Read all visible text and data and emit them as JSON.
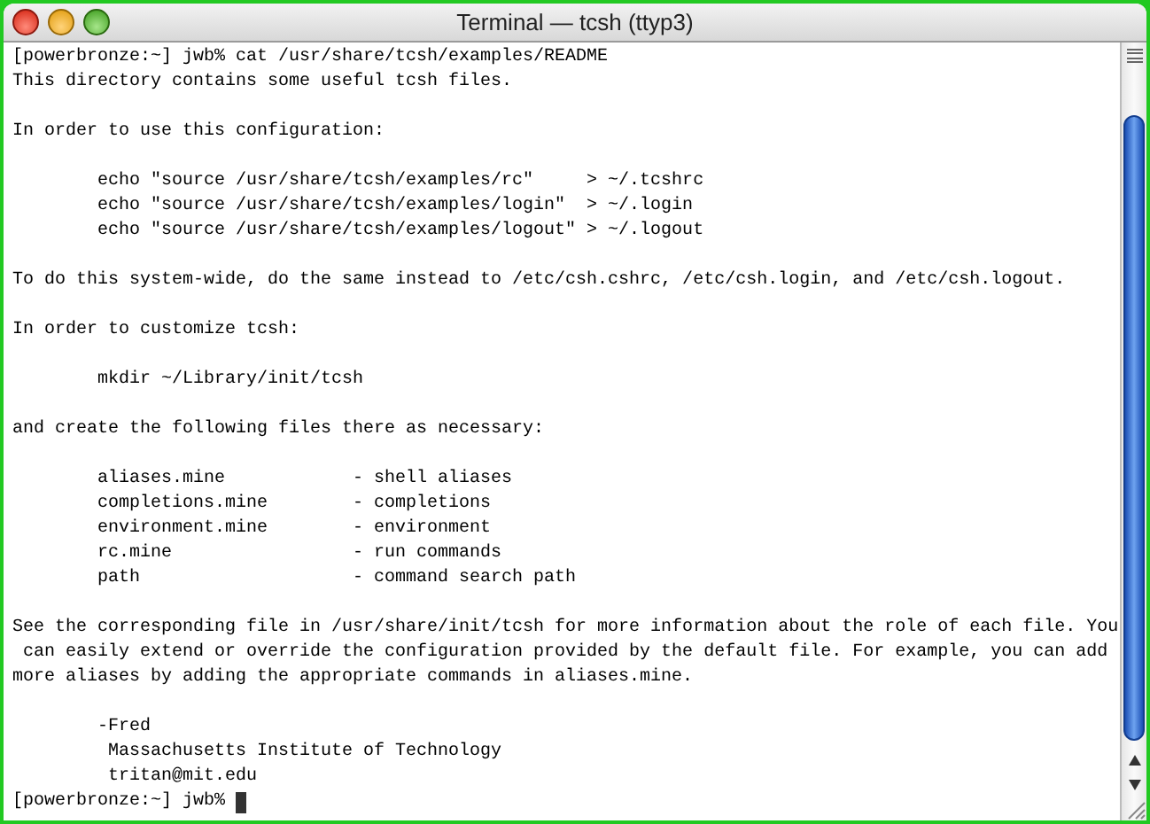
{
  "window": {
    "title": "Terminal — tcsh (ttyp3)"
  },
  "blocks": [
    {
      "lines": [
        {
          "text": "[powerbronze:~] jwb% cat /usr/share/tcsh/examples/README"
        },
        {
          "text": "This directory contains some useful tcsh files."
        }
      ]
    },
    {
      "lines": [
        {
          "text": "In order to use this configuration:"
        }
      ]
    },
    {
      "lines": [
        {
          "text": "        echo \"source /usr/share/tcsh/examples/rc\"     > ~/.tcshrc"
        },
        {
          "text": "        echo \"source /usr/share/tcsh/examples/login\"  > ~/.login"
        },
        {
          "text": "        echo \"source /usr/share/tcsh/examples/logout\" > ~/.logout"
        }
      ]
    },
    {
      "lines": [
        {
          "text": "To do this system-wide, do the same instead to /etc/csh.cshrc, /etc/csh.login, and /etc/csh.logout."
        }
      ]
    },
    {
      "lines": [
        {
          "text": "In order to customize tcsh:"
        }
      ]
    },
    {
      "lines": [
        {
          "text": "        mkdir ~/Library/init/tcsh"
        }
      ]
    },
    {
      "lines": [
        {
          "text": "and create the following files there as necessary:"
        }
      ]
    },
    {
      "lines": [
        {
          "text": "        aliases.mine            - shell aliases"
        },
        {
          "text": "        completions.mine        - completions"
        },
        {
          "text": "        environment.mine        - environment"
        },
        {
          "text": "        rc.mine                 - run commands"
        },
        {
          "text": "        path                    - command search path"
        }
      ]
    },
    {
      "lines": [
        {
          "text": "See the corresponding file in /usr/share/init/tcsh for more information about the role of each file. You"
        },
        {
          "text": " can easily extend or override the configuration provided by the default file. For example, you can add"
        },
        {
          "text": "more aliases by adding the appropriate commands in aliases.mine."
        }
      ]
    },
    {
      "lines": [
        {
          "text": "        -Fred"
        },
        {
          "text": "         Massachusetts Institute of Technology"
        },
        {
          "text": "         tritan@mit.edu"
        },
        {
          "text": "[powerbronze:~] jwb%",
          "cursor": true
        }
      ]
    }
  ]
}
